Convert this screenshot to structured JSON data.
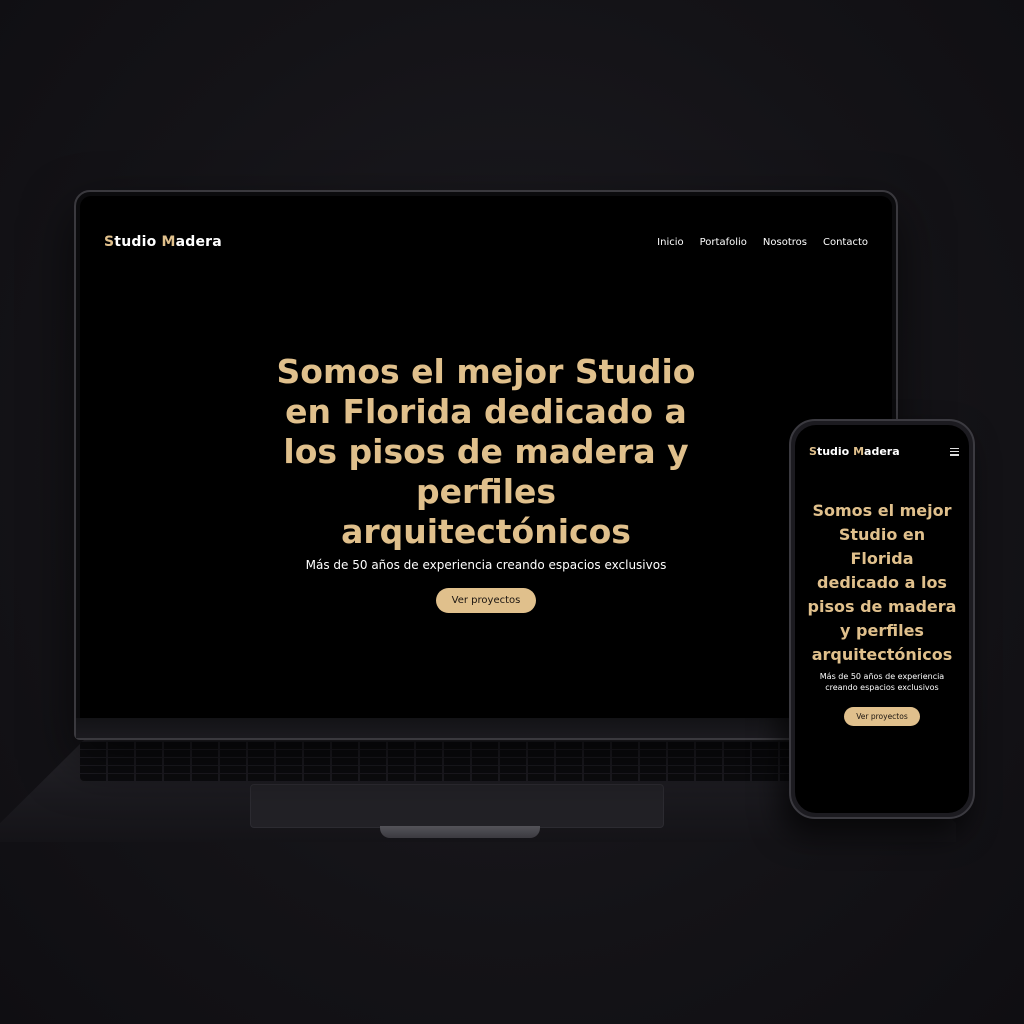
{
  "brand": {
    "initial_1": "S",
    "rest_1": "tudio ",
    "initial_2": "M",
    "rest_2": "adera",
    "accent_color": "#e0c08c"
  },
  "nav": {
    "items": [
      {
        "label": "Inicio"
      },
      {
        "label": "Portafolio"
      },
      {
        "label": "Nosotros"
      },
      {
        "label": "Contacto"
      }
    ]
  },
  "hero": {
    "title": "Somos el mejor Studio en Florida dedicado a los pisos de madera y perfiles arquitectónicos",
    "subtitle": "Más de 50 años de experiencia creando espacios exclusivos",
    "cta_label": "Ver proyectos"
  },
  "mobile": {
    "menu_icon": "hamburger-menu-icon"
  }
}
